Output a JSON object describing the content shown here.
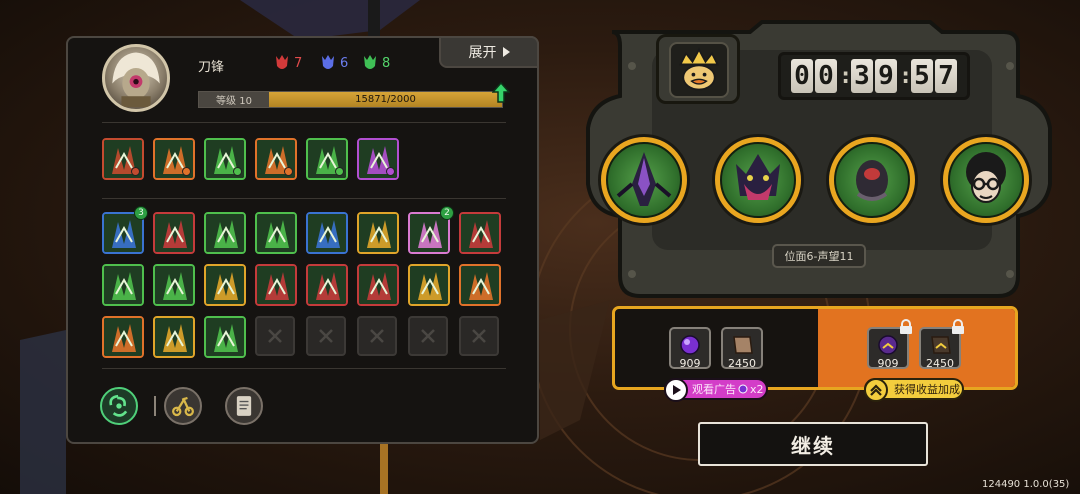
{
  "hero": {
    "name": "刀锋",
    "resources": [
      {
        "color": "#e24b4b",
        "value": "7"
      },
      {
        "color": "#6c7ef0",
        "value": "6"
      },
      {
        "color": "#53d46a",
        "value": "8"
      }
    ],
    "level_label": "等级 10",
    "xp_text": "15871/2000",
    "xp_fraction": 1.0
  },
  "panel": {
    "expand_label": "展开"
  },
  "skills_row1": [
    {
      "name": "claw-skill-icon",
      "border": "#c44b2f"
    },
    {
      "name": "flame-feathers-skill-icon",
      "border": "#e0722a"
    },
    {
      "name": "green-spike-skill-icon",
      "border": "#4fbf4d"
    },
    {
      "name": "fire-leaf-skill-icon",
      "border": "#e0722a"
    },
    {
      "name": "green-splash-skill-icon",
      "border": "#4fbf4d"
    },
    {
      "name": "green-beast-skill-icon",
      "border": "#b24fd1"
    }
  ],
  "skills_grid": [
    {
      "name": "blue-claw-skill-icon",
      "border": "#3a73d1",
      "level": "3"
    },
    {
      "name": "green-shield-skill-icon",
      "border": "#c43b3b"
    },
    {
      "name": "green-grass-skill-icon",
      "border": "#4fbf4d"
    },
    {
      "name": "v-leaf-skill-icon",
      "border": "#4fbf4d"
    },
    {
      "name": "shark-skill-icon",
      "border": "#3a73d1"
    },
    {
      "name": "arrow-burst-skill-icon",
      "border": "#e0a52a"
    },
    {
      "name": "pink-leaf-skill-icon",
      "border": "#d97bd1",
      "level": "2"
    },
    {
      "name": "red-slash-skill-icon",
      "border": "#c43b3b"
    },
    {
      "name": "red-arrow-skill-icon",
      "border": "#4fbf4d"
    },
    {
      "name": "green-spirit-skill-icon",
      "border": "#4fbf4d"
    },
    {
      "name": "trident-skill-icon",
      "border": "#e0a52a"
    },
    {
      "name": "fence-skill-icon",
      "border": "#c43b3b"
    },
    {
      "name": "vines-skill-icon",
      "border": "#c43b3b"
    },
    {
      "name": "dark-cat-skill-icon",
      "border": "#c43b3b"
    },
    {
      "name": "blue-vortex-skill-icon",
      "border": "#e0a52a"
    },
    {
      "name": "green-fist-skill-icon",
      "border": "#e0722a"
    },
    {
      "name": "purple-blade-skill-icon",
      "border": "#e0722a"
    },
    {
      "name": "bone-ribs-skill-icon",
      "border": "#e0a52a"
    },
    {
      "name": "pink-fish-skill-icon",
      "border": "#4fbf4d"
    }
  ],
  "empty_slots": 5,
  "timer": {
    "d1": "0",
    "d2": "0",
    "d3": "3",
    "d4": "9",
    "d5": "5",
    "d6": "7"
  },
  "position_label": "位面6-声望11",
  "rewards": {
    "free": [
      {
        "name": "purple-orb-icon",
        "value": "909"
      },
      {
        "name": "brown-scroll-icon",
        "value": "2450"
      }
    ],
    "boosted": [
      {
        "name": "purple-orb-icon",
        "value": "909"
      },
      {
        "name": "brown-scroll-icon",
        "value": "2450"
      }
    ],
    "watch_ad_label": "观看广告",
    "watch_ad_multiplier": "x2",
    "bonus_label": "获得收益加成"
  },
  "continue_label": "继续",
  "version": "124490 1.0.0(35)"
}
